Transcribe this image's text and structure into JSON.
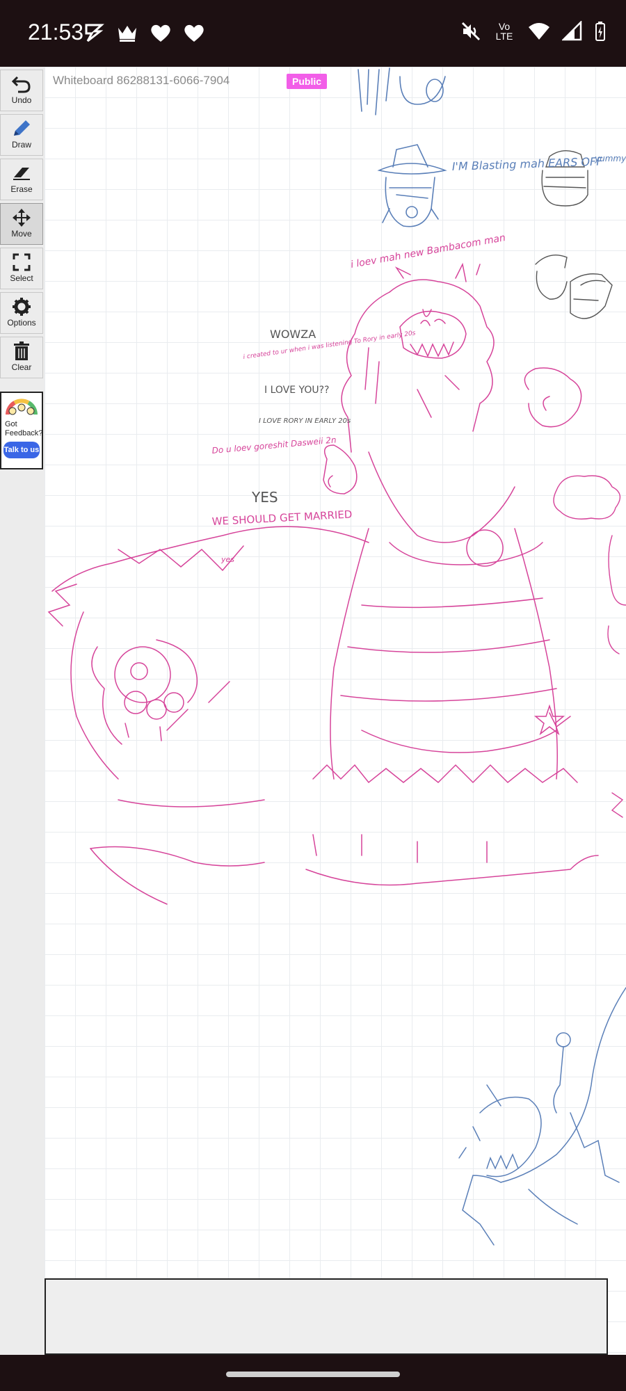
{
  "status_bar": {
    "time": "21:53",
    "left_icons": [
      "bolt-icon",
      "crown-icon",
      "heart-icon",
      "heart-icon"
    ],
    "network_label": "Vo LTE",
    "right_icons": [
      "muted-icon",
      "wifi-icon",
      "signal-icon",
      "battery-icon"
    ]
  },
  "whiteboard": {
    "title": "Whiteboard 86288131-6066-7904",
    "visibility_badge": "Public",
    "ink_colors": {
      "pink": "#d6449a",
      "blue": "#5a7fb8",
      "gray": "#555555"
    },
    "handwritten_notes": [
      "I'M Blasting mah EARS OFF",
      "yummy",
      "i loev mah new Bambacom man",
      "WOWZA",
      "i created to ur when i was listening To Rory in early 20s",
      "I LOVE YOU??",
      "I LOVE RORY IN EARLY 20s",
      "Do u loev goreshit Dasweii 2n",
      "YES",
      "WE SHOULD GET MARRIED",
      "yes"
    ]
  },
  "toolbar": {
    "tools": [
      {
        "label": "Undo",
        "icon": "undo-icon"
      },
      {
        "label": "Draw",
        "icon": "pencil-icon"
      },
      {
        "label": "Erase",
        "icon": "eraser-icon"
      },
      {
        "label": "Move",
        "icon": "move-icon"
      },
      {
        "label": "Select",
        "icon": "select-icon"
      },
      {
        "label": "Options",
        "icon": "gear-icon"
      },
      {
        "label": "Clear",
        "icon": "trash-icon"
      }
    ],
    "active_tool": "Move"
  },
  "feedback": {
    "line1": "Got",
    "line2": "Feedback?",
    "button_label": "Talk to us",
    "icon": "gauge-icon"
  },
  "text_input": {
    "value": ""
  }
}
